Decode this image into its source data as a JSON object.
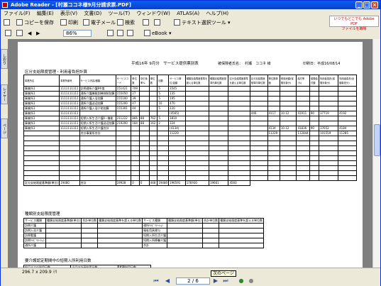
{
  "window": {
    "title": "Adobe Reader - [村瀬ココネ様9月分請求票.PDF]"
  },
  "menu": [
    "ファイル(F)",
    "編集(E)",
    "表示(V)",
    "文書(D)",
    "ツール(T)",
    "ウィンドウ(W)",
    "ATLAS(A)",
    "ヘルプ(H)"
  ],
  "toolbar1": {
    "save": "コピーを保存",
    "print": "印刷",
    "email": "電子メール",
    "search": "検索",
    "select": "テキスト選択ツール"
  },
  "toolbar2": {
    "zoom": "86%",
    "ebook": "eBook"
  },
  "ad": {
    "line1": "いつでもどこでも Adobe PDF",
    "line2": "ファイルを職場"
  },
  "sidetabs": [
    "しおり",
    "レイヤー",
    "ページ"
  ],
  "doc": {
    "header_title": "平成16年 9月分　サービス提供票別表",
    "insured_label": "被保険者氏名：",
    "insured_name": "村瀬　ココネ 様",
    "date": "印刷日：平成16/08/14",
    "section1": "区分支給限度管理・利用者負担計算",
    "cols": [
      "事業所名",
      "事業所番号",
      "サービス内容/種類",
      "サービスコード",
      "単位数",
      "割引後率%",
      "単位数",
      "回数",
      "サービス単位/金額",
      "種類支給限度基準を超える単位数",
      "種類支給限度基準内単位数",
      "区分支給限度基準を超える単位数",
      "区分支給限度基準内単位数",
      "単位数単価",
      "費用総額(保険対象分)",
      "給付率(%)",
      "保険給付額",
      "利用者負担(保険対象分)",
      "利用者負担(全額負担分)"
    ],
    "rows": [
      [
        "事業所1",
        "1111111111",
        "訪問通所介護Ⅱ中度",
        "151421",
        "709",
        "",
        "",
        "5",
        "3545",
        "",
        "",
        "",
        "",
        "",
        "",
        "",
        "",
        "",
        ""
      ],
      [
        "事業所1",
        "1111111111",
        "通所介護機能訓練体制加算",
        "155050",
        "27",
        "",
        "",
        "5",
        "135",
        "",
        "",
        "",
        "",
        "",
        "",
        "",
        "",
        "",
        ""
      ],
      [
        "事業所1",
        "1111111111",
        "通所介護入浴加算",
        "155100",
        "39",
        "",
        "",
        "5",
        "195",
        "",
        "",
        "",
        "",
        "",
        "",
        "",
        "",
        "",
        ""
      ],
      [
        "事業所1",
        "1111111111",
        "通所介護送迎加算",
        "155200",
        "47",
        "",
        "",
        "10",
        "470",
        "",
        "",
        "",
        "",
        "",
        "",
        "",
        "",
        "",
        ""
      ],
      [
        "事業所1",
        "1111111111",
        "通所介護入浴介助加算",
        "155301",
        "44",
        "",
        "",
        "5",
        "220",
        "",
        "",
        "",
        "",
        "",
        "",
        "",
        "",
        "",
        ""
      ],
      [
        "事業所1",
        "1111111111",
        "",
        "",
        "",
        "",
        "",
        "",
        "(4565)",
        "",
        "",
        "",
        "446",
        "4117",
        "10.12",
        "41911",
        "90",
        "37719",
        "4192"
      ],
      [
        "事業所1",
        "1111111111",
        "短期入所生活介護Ⅱ・機能",
        "211222",
        "866",
        "88",
        "762",
        "5",
        "3810",
        "",
        "",
        "",
        "",
        "",
        "",
        "",
        "",
        "",
        ""
      ],
      [
        "事業所1",
        "1111111111",
        "短期入所生活介護送迎加算",
        "219200",
        "184",
        "88",
        "162",
        "2",
        "324",
        "",
        "",
        "",
        "",
        "",
        "",
        "",
        "",
        "",
        ""
      ],
      [
        "事業所1",
        "1111111111",
        "短期入所生活介護合計",
        "",
        "",
        "",
        "",
        "",
        "(4134)",
        "",
        "",
        "",
        "",
        "4134",
        "10.12",
        "41836",
        "90",
        "37652",
        "4184"
      ],
      [
        "",
        "",
        "合計事業所合計",
        "",
        "",
        "",
        "",
        "",
        "11229",
        "",
        "",
        "",
        "",
        "11229",
        "",
        "112844",
        "",
        "101559",
        "11285"
      ]
    ],
    "row_extra": [
      "",
      "",
      "",
      "",
      "",
      "4560",
      "",
      "",
      "",
      "4560"
    ],
    "summary": {
      "label": "区分支給限度基準額(単位)",
      "limit": "19480",
      "total_label": "合計",
      "total": "19928",
      "v1": "0",
      "v2": "0",
      "v3": "448",
      "v4": "19480",
      "v5": "196591",
      "v6": "176930",
      "v7": "19661",
      "v8": "4560"
    },
    "section2": "種類別支給限度管理",
    "s2cols": [
      "サービス種類",
      "種類支給限度基準額(単位)",
      "合計単位数",
      "種類支給限度基準を超える単位数",
      "サービス種類",
      "種類支給限度基準額(単位)",
      "合計単位数",
      "種類支給限度基準を超える単位数"
    ],
    "s2rows": [
      [
        "訪問介護",
        "",
        "",
        "",
        "通所ﾘﾊﾋﾞﾘﾃｰｼｮﾝ",
        "",
        "",
        ""
      ],
      [
        "訪問入浴介護",
        "",
        "",
        "",
        "福祉用具貸与",
        "",
        "",
        ""
      ],
      [
        "訪問看護",
        "",
        "",
        "",
        "短期入所生活介護",
        "",
        "",
        ""
      ],
      [
        "訪問ﾘﾊﾋﾞﾘﾃｰｼｮﾝ",
        "",
        "",
        "",
        "短期入所療養介護",
        "",
        "",
        ""
      ],
      [
        "通所介護",
        "",
        "",
        "",
        "合計",
        "",
        "",
        ""
      ]
    ],
    "section3": "要介護認定期間中の短期入所利用日数",
    "s3cols": [
      "前月までの利用日数",
      "当月の計画利用日数",
      "累積利用日数"
    ]
  },
  "status": {
    "size": "296.7 x 209.9 ﾐﾘ"
  },
  "nav": {
    "page": "2 / 6",
    "tooltip": "次のページ"
  },
  "colors": {
    "titlebar": "#0a4fe0",
    "doc_bg": "#7f7f7f"
  }
}
